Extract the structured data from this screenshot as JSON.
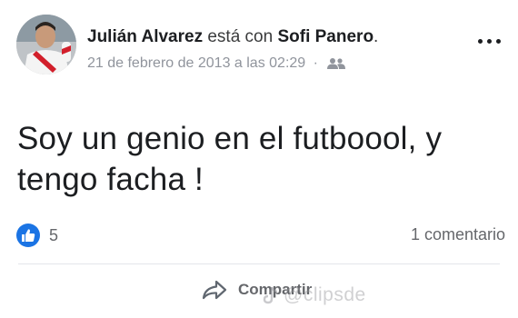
{
  "post": {
    "author": "Julián Alvarez",
    "verb": "está con",
    "tagged": "Sofi Panero",
    "period": ".",
    "timestamp": "21 de febrero de 2013 a las 02:29",
    "separator": "·",
    "audience_icon": "friends-icon",
    "text_line1": "Soy un genio en el futboool, y",
    "text_line2": "tengo facha !",
    "reaction_icon": "like-icon",
    "reaction_count": "5",
    "comment_count": "1 comentario",
    "share_label": "Compartir"
  },
  "watermark": {
    "text": "@clipsde",
    "icon": "tiktok-icon"
  },
  "colors": {
    "like_blue": "#1b74e4",
    "secondary_text": "#65676b",
    "primary_text": "#1c1e21"
  }
}
